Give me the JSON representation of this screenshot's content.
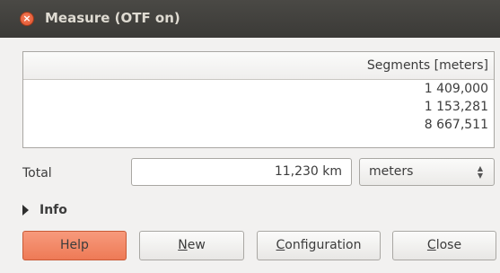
{
  "window": {
    "title": "Measure (OTF on)",
    "close_icon": "×"
  },
  "table": {
    "column_header": "Segments [meters]",
    "rows": [
      "1 409,000",
      "1 153,281",
      "8 667,511"
    ]
  },
  "total": {
    "label": "Total",
    "value": "11,230 km"
  },
  "units": {
    "selected": "meters"
  },
  "info": {
    "label": "Info",
    "expanded": false
  },
  "buttons": {
    "help": "Help",
    "new_mnemonic": "N",
    "new_rest": "ew",
    "config_mnemonic": "C",
    "config_rest": "onfiguration",
    "close_mnemonic": "C",
    "close_rest": "lose"
  },
  "colors": {
    "titlebar": "#3b3a37",
    "accent_help_button": "#ee7a56",
    "close_button": "#e0502a"
  }
}
